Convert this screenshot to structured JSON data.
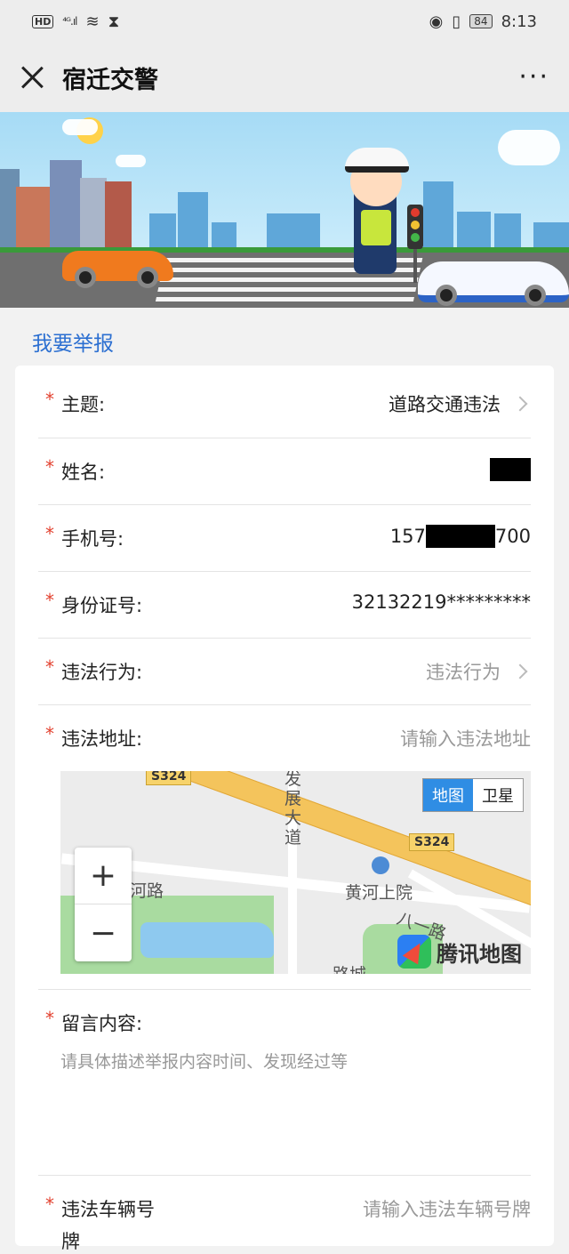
{
  "status_bar": {
    "left_badge": "HD",
    "signal": "⁴ᴳ.ıl",
    "battery": "84",
    "time": "8:13"
  },
  "title_bar": {
    "title": "宿迁交警",
    "more": "···"
  },
  "section": {
    "title": "我要举报"
  },
  "form": {
    "required_mark": "*",
    "subject": {
      "label": "主题:",
      "value": "道路交通违法"
    },
    "name": {
      "label": "姓名:"
    },
    "phone": {
      "label": "手机号:",
      "prefix": "157",
      "suffix": "700"
    },
    "id_number": {
      "label": "身份证号:",
      "value": "32132219*********"
    },
    "violation": {
      "label": "违法行为:",
      "placeholder": "违法行为"
    },
    "address": {
      "label": "违法地址:",
      "placeholder": "请输入违法地址"
    },
    "message": {
      "label": "留言内容:",
      "placeholder": "请具体描述举报内容时间、发现经过等"
    },
    "plate": {
      "label": "违法车辆号",
      "label_cont": "牌",
      "placeholder": "请输入违法车辆号牌"
    }
  },
  "map": {
    "toggle_map": "地图",
    "toggle_satellite": "卫星",
    "zoom_in": "+",
    "zoom_out": "−",
    "labels": {
      "road_s324_a": "S324",
      "road_s324_b": "S324",
      "fazhan": "发展大道",
      "hehe_road": "河路",
      "huanghe": "黄河上院",
      "bayi": "八一路",
      "bottom": "路城"
    },
    "provider": "腾讯地图"
  }
}
